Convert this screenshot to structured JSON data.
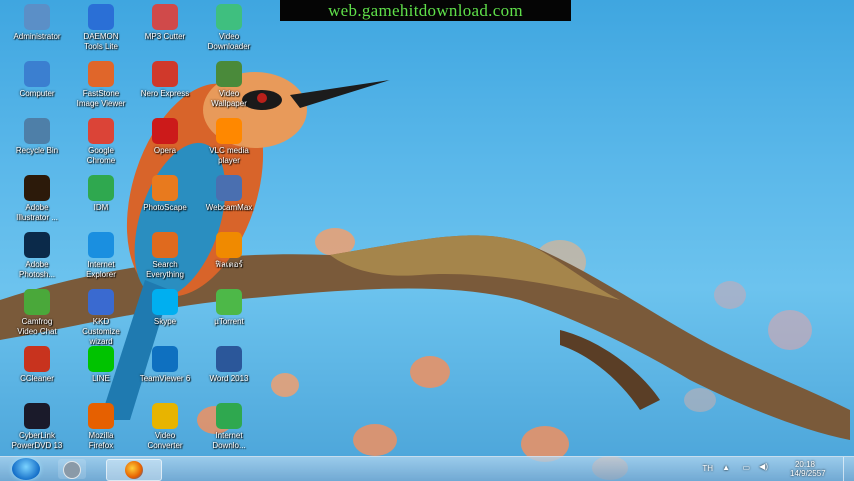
{
  "banner": "web.gamehitdownload.com",
  "desktop_icons": [
    {
      "label": "Administrator",
      "icon": "user-folder-icon",
      "color": "#5b8fc7"
    },
    {
      "label": "DAEMON\nTools Lite",
      "icon": "daemon-tools-icon",
      "color": "#2a6fd6"
    },
    {
      "label": "MP3 Cutter",
      "icon": "scissors-icon",
      "color": "#d04a4a"
    },
    {
      "label": "Video\nDownloader",
      "icon": "video-downloader-icon",
      "color": "#3fbf7f"
    },
    {
      "label": "Computer",
      "icon": "computer-icon",
      "color": "#3b7fd0"
    },
    {
      "label": "FastStone\nImage Viewer",
      "icon": "faststone-icon",
      "color": "#e0662a"
    },
    {
      "label": "Nero Express",
      "icon": "nero-icon",
      "color": "#d0392b"
    },
    {
      "label": "Video\nWallpaper",
      "icon": "video-wallpaper-icon",
      "color": "#4a8a3a"
    },
    {
      "label": "Recycle Bin",
      "icon": "recycle-bin-icon",
      "color": "#4e7fa8"
    },
    {
      "label": "Google\nChrome",
      "icon": "chrome-icon",
      "color": "#db4437"
    },
    {
      "label": "Opera",
      "icon": "opera-icon",
      "color": "#cc1a1a"
    },
    {
      "label": "VLC media\nplayer",
      "icon": "vlc-icon",
      "color": "#ff8800"
    },
    {
      "label": "Adobe\nIllustrator ...",
      "icon": "illustrator-icon",
      "color": "#2c1a0a"
    },
    {
      "label": "IDM",
      "icon": "idm-icon",
      "color": "#2fa84f"
    },
    {
      "label": "PhotoScape",
      "icon": "photoscape-icon",
      "color": "#e87a1e"
    },
    {
      "label": "WebcamMax",
      "icon": "webcam-icon",
      "color": "#4a6fb0"
    },
    {
      "label": "Adobe\nPhotosh...",
      "icon": "photoshop-icon",
      "color": "#0b2a4a"
    },
    {
      "label": "Internet\nExplorer",
      "icon": "ie-icon",
      "color": "#1a8fe0"
    },
    {
      "label": "Search\nEverything",
      "icon": "search-icon",
      "color": "#e06a1e"
    },
    {
      "label": "ฟิลเตอร์",
      "icon": "avast-icon",
      "color": "#f08a00"
    },
    {
      "label": "Camfrog\nVideo Chat",
      "icon": "camfrog-icon",
      "color": "#4aa83a"
    },
    {
      "label": "KKD\nCustomize\nwizard",
      "icon": "kkd-icon",
      "color": "#3a6ad0"
    },
    {
      "label": "Skype",
      "icon": "skype-icon",
      "color": "#00aff0"
    },
    {
      "label": "µTorrent",
      "icon": "utorrent-icon",
      "color": "#4db848"
    },
    {
      "label": "CCleaner",
      "icon": "ccleaner-icon",
      "color": "#c8331e"
    },
    {
      "label": "LINE",
      "icon": "line-icon",
      "color": "#00c300"
    },
    {
      "label": "TeamViewer 6",
      "icon": "teamviewer-icon",
      "color": "#0e70c0"
    },
    {
      "label": "Word 2013",
      "icon": "word-icon",
      "color": "#2b579a"
    },
    {
      "label": "CyberLink\nPowerDVD 13",
      "icon": "powerdvd-icon",
      "color": "#1a1a2a"
    },
    {
      "label": "Mozilla\nFirefox",
      "icon": "firefox-icon",
      "color": "#e66000"
    },
    {
      "label": "Video\nConverter",
      "icon": "video-converter-icon",
      "color": "#e8b400"
    },
    {
      "label": "Internet\nDownlo...",
      "icon": "internet-download-icon",
      "color": "#2fa84f"
    }
  ],
  "taskbar": {
    "pinned": [
      {
        "name": "start-button",
        "icon": "windows-orb-icon"
      },
      {
        "name": "taskbar-app-1",
        "icon": "app-gray-icon"
      },
      {
        "name": "taskbar-firefox",
        "icon": "firefox-icon"
      }
    ],
    "language": "TH",
    "time": "20:18",
    "date": "14/9/2557"
  }
}
